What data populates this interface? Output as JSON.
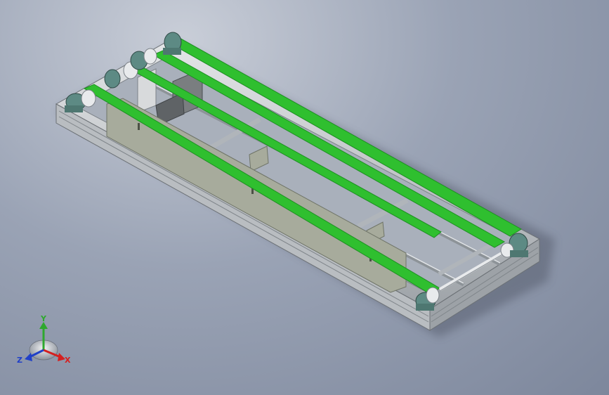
{
  "view": {
    "background": {
      "top": "#c9ced8",
      "mid": "#9aa3b5",
      "bottom": "#7d879c"
    }
  },
  "colors": {
    "belt": "#2fbf2f",
    "belt_dark": "#1d8f22",
    "frame": "#c4c8cc",
    "frame_dark": "#7c8288",
    "guard": "#a7ab9c",
    "guard_dark": "#6f7467",
    "bearing": "#5d8a84",
    "shaft": "#e8eaec"
  },
  "triad": {
    "icon": "coordinate-triad-icon",
    "y_label": "Y",
    "x_label": "X",
    "z_label": "Z",
    "y_color": "#2ea82e",
    "x_color": "#d42020",
    "z_color": "#2040c8"
  }
}
